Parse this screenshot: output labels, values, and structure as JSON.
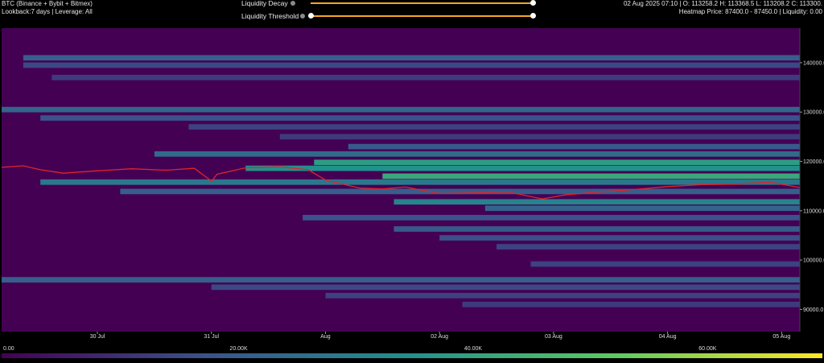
{
  "header": {
    "title": "BTC (Binance + Bybit + Bitmex)",
    "subtitle": "Lookback:7 days | Leverage: All",
    "ohlc": "02 Aug 2025 07:10 | O: 113258.2 H: 113368.5 L: 113208.2 C: 113300.",
    "heatmap_info": "Heatmap Price: 87400.0 - 87450.0 | Liquidity: 0.00"
  },
  "controls": {
    "decay_label": "Liquidity Decay",
    "decay_value": 1.0,
    "threshold_label": "Liquidity Threshold",
    "threshold_value": 0.0
  },
  "colors": {
    "background": "#440154",
    "scale": [
      "#440154",
      "#3b528b",
      "#21918c",
      "#5ec962",
      "#fde725"
    ],
    "price_line": "#e0242a",
    "slider": "#f5a623"
  },
  "colorbar": {
    "labels": [
      "0.00",
      "20.00K",
      "40.00K",
      "60.00K"
    ],
    "values": [
      0,
      20000,
      40000,
      60000
    ],
    "max": 70000
  },
  "chart_data": {
    "type": "heatmap",
    "title": "",
    "x_ticks": [
      "30 Jul",
      "31 Jul",
      "Aug",
      "02 Aug",
      "03 Aug",
      "04 Aug",
      "05 Aug"
    ],
    "x_tick_days": [
      1,
      2,
      3,
      4,
      5,
      6,
      7
    ],
    "x_range_days": [
      0.16,
      7.16
    ],
    "y_ticks": [
      "140000.0",
      "130000.0",
      "120000.0",
      "110000.0",
      "100000.0",
      "90000.0"
    ],
    "y_tick_values": [
      140000,
      130000,
      120000,
      110000,
      100000,
      90000
    ],
    "ylim": [
      85500,
      147000
    ],
    "price_series": {
      "x_days": [
        0.16,
        0.35,
        0.5,
        0.7,
        1.0,
        1.3,
        1.6,
        1.85,
        2.0,
        2.05,
        2.3,
        2.6,
        2.85,
        3.0,
        3.3,
        3.5,
        3.7,
        4.0,
        4.3,
        4.6,
        4.9,
        5.1,
        5.4,
        5.7,
        6.0,
        6.3,
        6.6,
        6.9,
        7.16
      ],
      "price": [
        118800,
        119100,
        118300,
        117600,
        118100,
        118500,
        118200,
        118600,
        116000,
        117400,
        118700,
        118900,
        118300,
        116200,
        114600,
        114400,
        114800,
        113500,
        113600,
        113800,
        112400,
        113200,
        113800,
        114300,
        114900,
        115300,
        115400,
        115800,
        114700
      ]
    },
    "bands": [
      {
        "price": 141000,
        "intensity": 0.3,
        "start_day": 0.35
      },
      {
        "price": 139500,
        "intensity": 0.22,
        "start_day": 0.35
      },
      {
        "price": 137000,
        "intensity": 0.18,
        "start_day": 0.6
      },
      {
        "price": 130500,
        "intensity": 0.32,
        "start_day": 0.16
      },
      {
        "price": 128800,
        "intensity": 0.25,
        "start_day": 0.5
      },
      {
        "price": 127000,
        "intensity": 0.2,
        "start_day": 1.8
      },
      {
        "price": 125000,
        "intensity": 0.18,
        "start_day": 2.6
      },
      {
        "price": 123000,
        "intensity": 0.28,
        "start_day": 3.2
      },
      {
        "price": 121500,
        "intensity": 0.35,
        "start_day": 1.5
      },
      {
        "price": 119800,
        "intensity": 0.55,
        "start_day": 2.9
      },
      {
        "price": 118600,
        "intensity": 0.5,
        "start_day": 2.3
      },
      {
        "price": 117000,
        "intensity": 0.6,
        "start_day": 3.5
      },
      {
        "price": 115800,
        "intensity": 0.4,
        "start_day": 0.5
      },
      {
        "price": 113900,
        "intensity": 0.3,
        "start_day": 1.2
      },
      {
        "price": 111800,
        "intensity": 0.45,
        "start_day": 3.6
      },
      {
        "price": 110500,
        "intensity": 0.32,
        "start_day": 4.4
      },
      {
        "price": 108600,
        "intensity": 0.25,
        "start_day": 2.8
      },
      {
        "price": 106300,
        "intensity": 0.28,
        "start_day": 3.6
      },
      {
        "price": 104500,
        "intensity": 0.24,
        "start_day": 4.0
      },
      {
        "price": 102700,
        "intensity": 0.2,
        "start_day": 4.5
      },
      {
        "price": 99200,
        "intensity": 0.2,
        "start_day": 4.8
      },
      {
        "price": 96000,
        "intensity": 0.3,
        "start_day": 0.16
      },
      {
        "price": 94500,
        "intensity": 0.22,
        "start_day": 2.0
      },
      {
        "price": 92800,
        "intensity": 0.2,
        "start_day": 3.0
      },
      {
        "price": 91000,
        "intensity": 0.18,
        "start_day": 4.2
      }
    ]
  }
}
